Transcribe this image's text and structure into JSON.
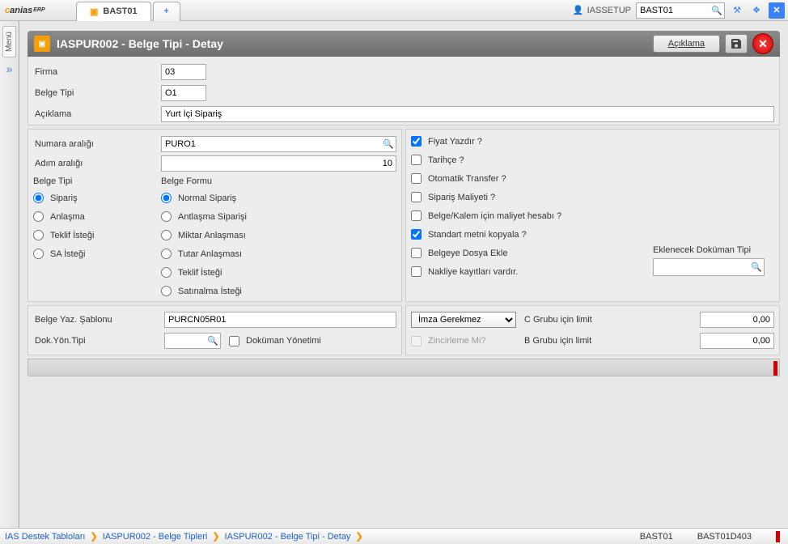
{
  "app": {
    "logo_prefix": "c",
    "logo_main": "anias",
    "logo_suffix": "ERP"
  },
  "tabs": {
    "active": "BAST01",
    "add": "+"
  },
  "topbar": {
    "user": "IASSETUP",
    "search_value": "BAST01"
  },
  "leftmenu": {
    "label": "Menü"
  },
  "window": {
    "title": "IASPUR002 - Belge Tipi - Detay",
    "btn_aciklama": "Açıklama"
  },
  "header": {
    "firma_label": "Firma",
    "firma_value": "03",
    "belgetipi_label": "Belge Tipi",
    "belgetipi_value": "O1",
    "aciklama_label": "Açıklama",
    "aciklama_value": "Yurt İçi Sipariş"
  },
  "left_panel": {
    "numara_label": "Numara aralığı",
    "numara_value": "PURO1",
    "adim_label": "Adım aralığı",
    "adim_value": "10",
    "belgetipi_group": "Belge Tipi",
    "belgeformu_group": "Belge Formu",
    "bt": [
      "Sipariş",
      "Anlaşma",
      "Teklif İsteği",
      "SA İsteği"
    ],
    "bf": [
      "Normal Sipariş",
      "Antlaşma Siparişi",
      "Miktar Anlaşması",
      "Tutar Anlaşması",
      "Teklif İsteği",
      "Satınalma İsteği"
    ]
  },
  "right_panel": {
    "checks": [
      {
        "label": "Fiyat Yazdır ?",
        "checked": true
      },
      {
        "label": "Tarihçe ?",
        "checked": false
      },
      {
        "label": "Otomatik Transfer ?",
        "checked": false
      },
      {
        "label": "Sipariş Maliyeti ?",
        "checked": false
      },
      {
        "label": "Belge/Kalem için maliyet hesabı ?",
        "checked": false
      },
      {
        "label": "Standart metni kopyala ?",
        "checked": true
      },
      {
        "label": "Belgeye Dosya Ekle",
        "checked": false
      },
      {
        "label": "Nakliye kayıtları vardır.",
        "checked": false
      }
    ],
    "doc_type_label": "Eklenecek Doküman Tipi",
    "doc_type_value": ""
  },
  "bottom_left": {
    "sablon_label": "Belge Yaz. Şablonu",
    "sablon_value": "PURCN05R01",
    "doktipi_label": "Dok.Yön.Tipi",
    "doktipi_value": "",
    "dokyonetimi_label": "Doküman Yönetimi"
  },
  "bottom_right": {
    "imza_value": "İmza Gerekmez",
    "c_label": "C Grubu için limit",
    "c_value": "0,00",
    "zincirleme_label": "Zincirleme Mi?",
    "b_label": "B Grubu için limit",
    "b_value": "0,00"
  },
  "breadcrumbs": [
    "IAS Destek Tabloları",
    "IASPUR002 - Belge Tipleri",
    "IASPUR002 - Belge Tipi - Detay"
  ],
  "status": {
    "code1": "BAST01",
    "code2": "BAST01D403"
  }
}
